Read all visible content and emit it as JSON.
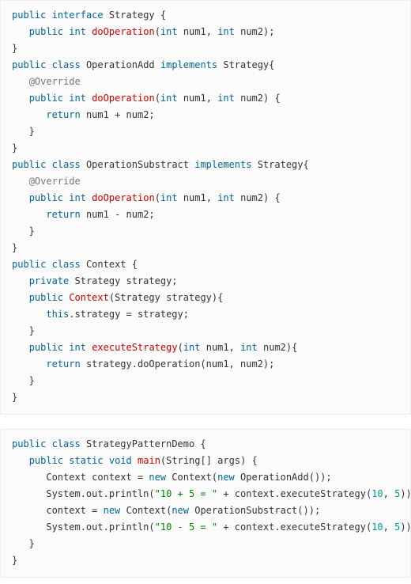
{
  "block1": {
    "lines": [
      [
        [
          "kw",
          "public"
        ],
        [
          "p",
          " "
        ],
        [
          "kw",
          "interface"
        ],
        [
          "p",
          " Strategy {"
        ]
      ],
      [
        [
          "p",
          "   "
        ],
        [
          "kw",
          "public"
        ],
        [
          "p",
          " "
        ],
        [
          "kw",
          "int"
        ],
        [
          "p",
          " "
        ],
        [
          "fn",
          "doOperation"
        ],
        [
          "p",
          "("
        ],
        [
          "kw",
          "int"
        ],
        [
          "p",
          " num1, "
        ],
        [
          "kw",
          "int"
        ],
        [
          "p",
          " num2);"
        ]
      ],
      [
        [
          "p",
          "}"
        ]
      ],
      [
        [
          "kw",
          "public"
        ],
        [
          "p",
          " "
        ],
        [
          "kw",
          "class"
        ],
        [
          "p",
          " OperationAdd "
        ],
        [
          "kw",
          "implements"
        ],
        [
          "p",
          " Strategy{"
        ]
      ],
      [
        [
          "p",
          "   "
        ],
        [
          "ann",
          "@Override"
        ]
      ],
      [
        [
          "p",
          "   "
        ],
        [
          "kw",
          "public"
        ],
        [
          "p",
          " "
        ],
        [
          "kw",
          "int"
        ],
        [
          "p",
          " "
        ],
        [
          "fn",
          "doOperation"
        ],
        [
          "p",
          "("
        ],
        [
          "kw",
          "int"
        ],
        [
          "p",
          " num1, "
        ],
        [
          "kw",
          "int"
        ],
        [
          "p",
          " num2) {"
        ]
      ],
      [
        [
          "p",
          "      "
        ],
        [
          "kw",
          "return"
        ],
        [
          "p",
          " num1 + num2;"
        ]
      ],
      [
        [
          "p",
          "   }"
        ]
      ],
      [
        [
          "p",
          "}"
        ]
      ],
      [
        [
          "kw",
          "public"
        ],
        [
          "p",
          " "
        ],
        [
          "kw",
          "class"
        ],
        [
          "p",
          " OperationSubstract "
        ],
        [
          "kw",
          "implements"
        ],
        [
          "p",
          " Strategy{"
        ]
      ],
      [
        [
          "p",
          "   "
        ],
        [
          "ann",
          "@Override"
        ]
      ],
      [
        [
          "p",
          "   "
        ],
        [
          "kw",
          "public"
        ],
        [
          "p",
          " "
        ],
        [
          "kw",
          "int"
        ],
        [
          "p",
          " "
        ],
        [
          "fn",
          "doOperation"
        ],
        [
          "p",
          "("
        ],
        [
          "kw",
          "int"
        ],
        [
          "p",
          " num1, "
        ],
        [
          "kw",
          "int"
        ],
        [
          "p",
          " num2) {"
        ]
      ],
      [
        [
          "p",
          "      "
        ],
        [
          "kw",
          "return"
        ],
        [
          "p",
          " num1 - num2;"
        ]
      ],
      [
        [
          "p",
          "   }"
        ]
      ],
      [
        [
          "p",
          "}"
        ]
      ],
      [
        [
          "kw",
          "public"
        ],
        [
          "p",
          " "
        ],
        [
          "kw",
          "class"
        ],
        [
          "p",
          " Context {"
        ]
      ],
      [
        [
          "p",
          "   "
        ],
        [
          "kw",
          "private"
        ],
        [
          "p",
          " Strategy strategy;"
        ]
      ],
      [
        [
          "p",
          "   "
        ],
        [
          "kw",
          "public"
        ],
        [
          "p",
          " "
        ],
        [
          "fn",
          "Context"
        ],
        [
          "p",
          "(Strategy strategy){"
        ]
      ],
      [
        [
          "p",
          "      "
        ],
        [
          "kw",
          "this"
        ],
        [
          "p",
          ".strategy = strategy;"
        ]
      ],
      [
        [
          "p",
          "   }"
        ]
      ],
      [
        [
          "p",
          "   "
        ],
        [
          "kw",
          "public"
        ],
        [
          "p",
          " "
        ],
        [
          "kw",
          "int"
        ],
        [
          "p",
          " "
        ],
        [
          "fn",
          "executeStrategy"
        ],
        [
          "p",
          "("
        ],
        [
          "kw",
          "int"
        ],
        [
          "p",
          " num1, "
        ],
        [
          "kw",
          "int"
        ],
        [
          "p",
          " num2){"
        ]
      ],
      [
        [
          "p",
          "      "
        ],
        [
          "kw",
          "return"
        ],
        [
          "p",
          " strategy.doOperation(num1, num2);"
        ]
      ],
      [
        [
          "p",
          "   }"
        ]
      ],
      [
        [
          "p",
          "}"
        ]
      ]
    ]
  },
  "block2": {
    "lines": [
      [
        [
          "kw",
          "public"
        ],
        [
          "p",
          " "
        ],
        [
          "kw",
          "class"
        ],
        [
          "p",
          " StrategyPatternDemo {"
        ]
      ],
      [
        [
          "p",
          "   "
        ],
        [
          "kw",
          "public"
        ],
        [
          "p",
          " "
        ],
        [
          "kw",
          "static"
        ],
        [
          "p",
          " "
        ],
        [
          "kw",
          "void"
        ],
        [
          "p",
          " "
        ],
        [
          "fn",
          "main"
        ],
        [
          "p",
          "(String[] args) {"
        ]
      ],
      [
        [
          "p",
          "      Context context = "
        ],
        [
          "kw",
          "new"
        ],
        [
          "p",
          " Context("
        ],
        [
          "kw",
          "new"
        ],
        [
          "p",
          " OperationAdd());"
        ]
      ],
      [
        [
          "p",
          "      System.out.println("
        ],
        [
          "str",
          "\"10 + 5 = \""
        ],
        [
          "p",
          " + context.executeStrategy("
        ],
        [
          "num",
          "10"
        ],
        [
          "p",
          ", "
        ],
        [
          "num",
          "5"
        ],
        [
          "p",
          "));"
        ]
      ],
      [
        [
          "p",
          "      context = "
        ],
        [
          "kw",
          "new"
        ],
        [
          "p",
          " Context("
        ],
        [
          "kw",
          "new"
        ],
        [
          "p",
          " OperationSubstract());"
        ]
      ],
      [
        [
          "p",
          "      System.out.println("
        ],
        [
          "str",
          "\"10 - 5 = \""
        ],
        [
          "p",
          " + context.executeStrategy("
        ],
        [
          "num",
          "10"
        ],
        [
          "p",
          ", "
        ],
        [
          "num",
          "5"
        ],
        [
          "p",
          "));"
        ]
      ],
      [
        [
          "p",
          "   }"
        ]
      ],
      [
        [
          "p",
          "}"
        ]
      ]
    ]
  }
}
